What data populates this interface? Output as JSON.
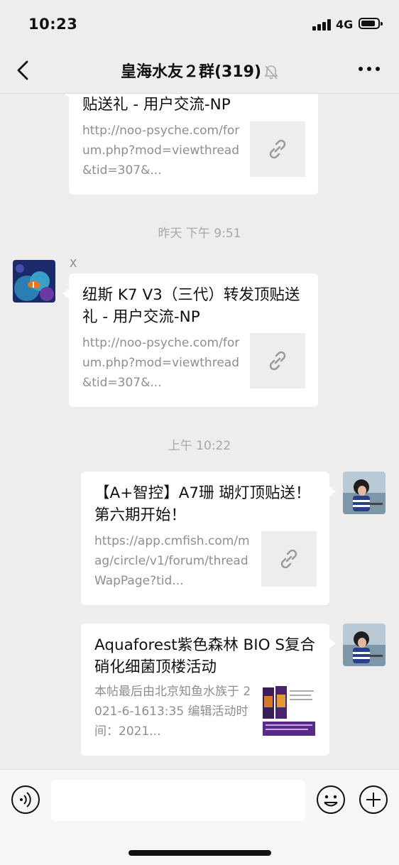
{
  "status_bar": {
    "time": "10:23",
    "network": "4G"
  },
  "header": {
    "title": "皇海水友２群(319)"
  },
  "messages": [
    {
      "title": "贴送礼 - 用户交流-NP",
      "url": "http://noo-psyche.com/forum.php?mod=viewthread&tid=307&..."
    },
    {
      "timestamp": "昨天 下午 9:51",
      "sender": "X",
      "title": "纽斯 K7 V3（三代）转发顶贴送礼 - 用户交流-NP",
      "url": "http://noo-psyche.com/forum.php?mod=viewthread&tid=307&..."
    },
    {
      "timestamp": "上午 10:22",
      "title": "【A+智控】A7珊 瑚灯顶贴送！第六期开始！",
      "url": "https://app.cmfish.com/mag/circle/v1/forum/threadWapPage?tid..."
    },
    {
      "title": "Aquaforest紫色森林 BIO S复合硝化细菌顶楼活动",
      "desc": "本帖最后由北京知鱼水族于 2021-6-1613:35 编辑活动时间：2021..."
    }
  ],
  "icons": {
    "back": "chevron-left-icon",
    "mute": "bell-off-icon",
    "more": "more-dots-icon",
    "link": "link-icon",
    "voice": "voice-icon",
    "emoji": "emoji-icon",
    "add": "plus-circle-icon"
  },
  "colors": {
    "background": "#ededed",
    "bubble": "#ffffff",
    "meta_text": "#8e8e8e",
    "timestamp": "#a7a7a7"
  }
}
